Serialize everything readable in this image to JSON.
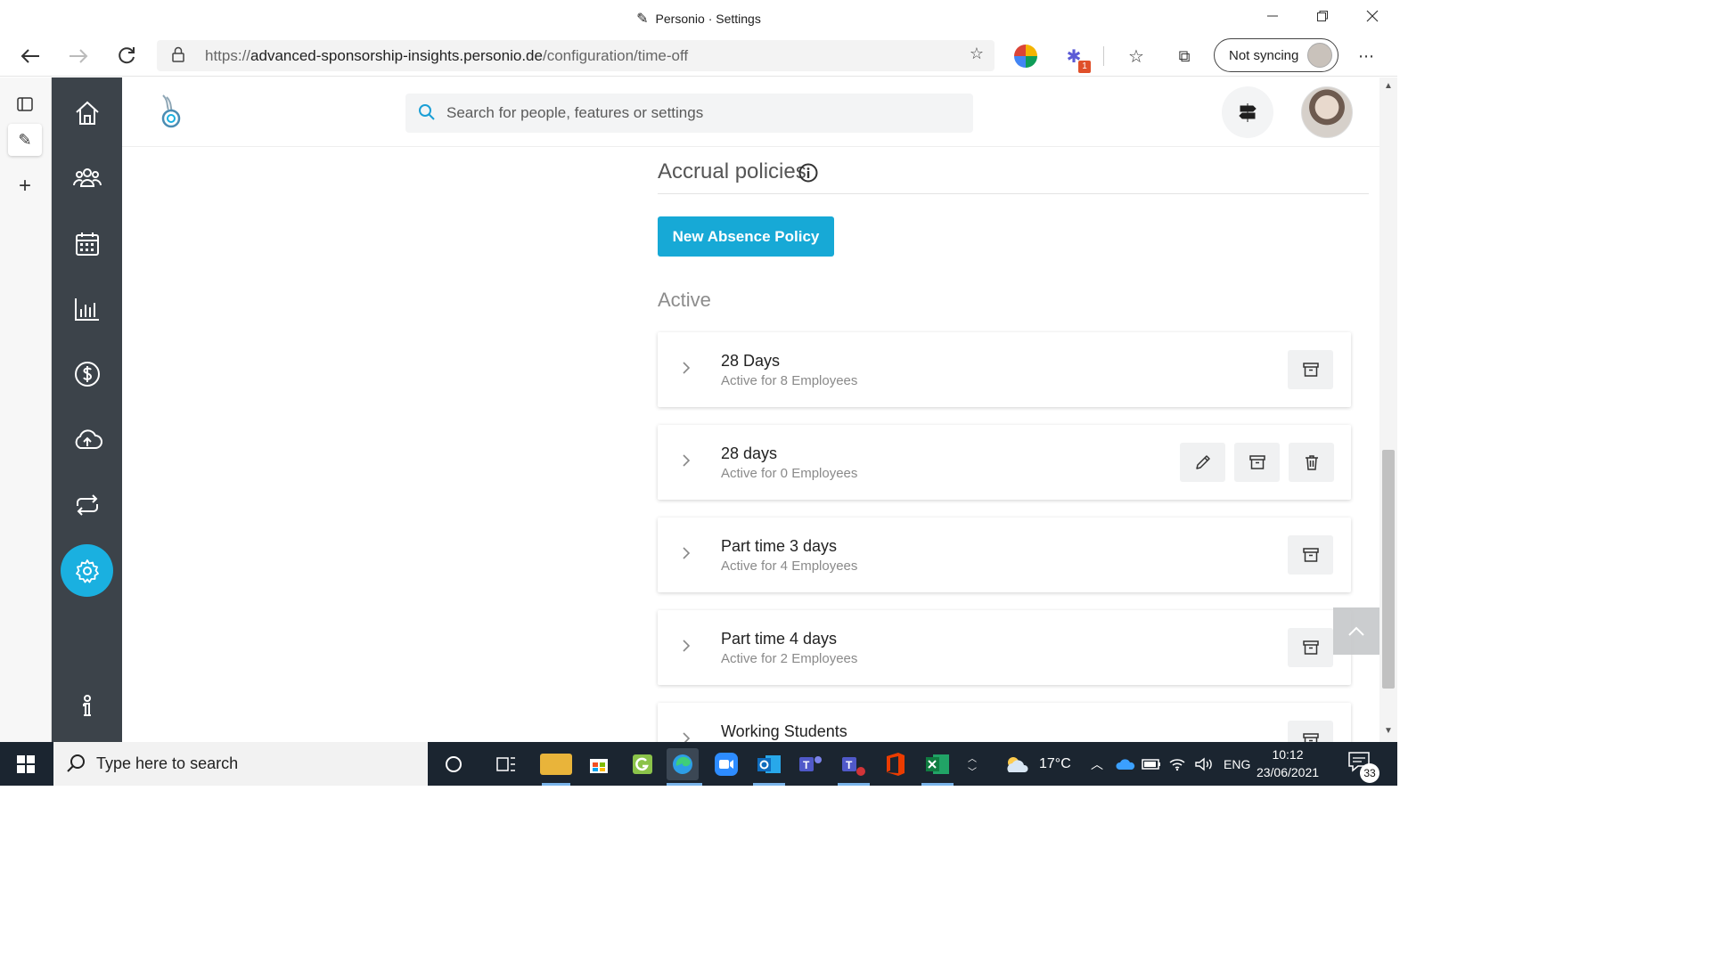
{
  "window": {
    "title": "Personio · Settings"
  },
  "browser": {
    "url_prefix": "https://",
    "url_host": "advanced-sponsorship-insights.personio.de",
    "url_path": "/configuration/time-off",
    "profile_label": "Not syncing",
    "extension_badge": "1"
  },
  "app": {
    "search_placeholder": "Search for people, features or settings",
    "nav": [
      {
        "name": "home"
      },
      {
        "name": "people"
      },
      {
        "name": "calendar"
      },
      {
        "name": "analytics"
      },
      {
        "name": "payroll"
      },
      {
        "name": "upload"
      },
      {
        "name": "sync"
      },
      {
        "name": "settings",
        "active": true
      },
      {
        "name": "help"
      }
    ]
  },
  "content": {
    "section_title": "Accrual policies",
    "new_policy_label": "New Absence Policy",
    "active_label": "Active",
    "policies": [
      {
        "name": "28 Days",
        "subtitle": "Active for 8 Employees",
        "actions": [
          "archive"
        ]
      },
      {
        "name": "28 days",
        "subtitle": "Active for 0 Employees",
        "actions": [
          "edit",
          "archive",
          "delete"
        ]
      },
      {
        "name": "Part time 3 days",
        "subtitle": "Active for 4 Employees",
        "actions": [
          "archive"
        ]
      },
      {
        "name": "Part time 4 days",
        "subtitle": "Active for 2 Employees",
        "actions": [
          "archive"
        ]
      },
      {
        "name": "Working Students",
        "subtitle": "",
        "actions": [
          "archive"
        ]
      }
    ]
  },
  "taskbar": {
    "search_placeholder": "Type here to search",
    "weather": "17°C",
    "language": "ENG",
    "time": "10:12",
    "date": "23/06/2021",
    "notifications": "33"
  },
  "colors": {
    "accent": "#17a9d6",
    "nav_bg": "#3c434a",
    "taskbar_bg": "#1b2530"
  }
}
